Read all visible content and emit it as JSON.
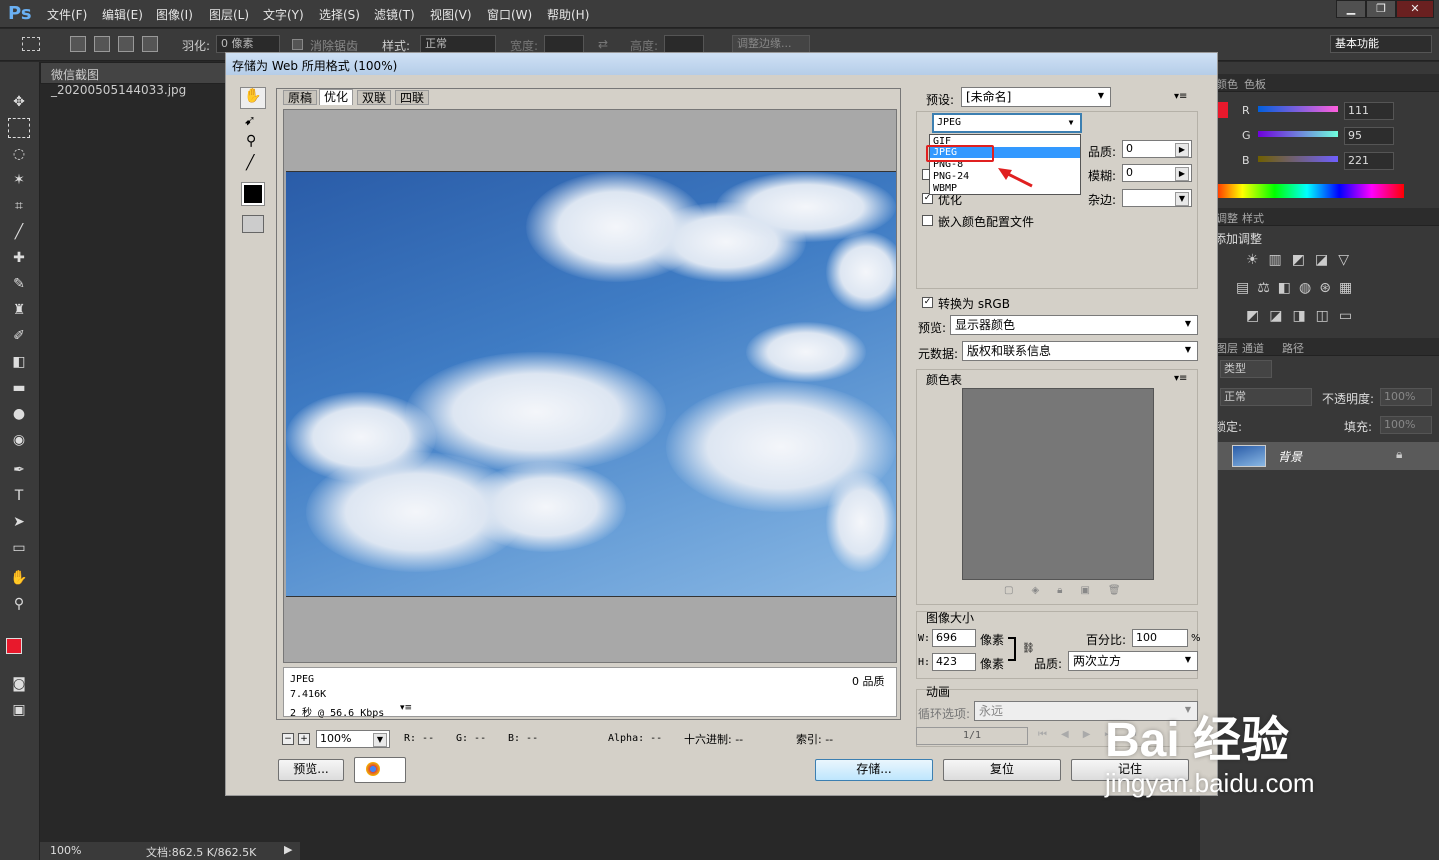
{
  "app": {
    "logo": "Ps"
  },
  "menu": [
    "文件(F)",
    "编辑(E)",
    "图像(I)",
    "图层(L)",
    "文字(Y)",
    "选择(S)",
    "滤镜(T)",
    "视图(V)",
    "窗口(W)",
    "帮助(H)"
  ],
  "window_controls": {
    "min": "▁",
    "restore": "❐",
    "close": "✕"
  },
  "options": {
    "feather_label": "羽化:",
    "feather_value": "0 像素",
    "antialias": "消除锯齿",
    "style_label": "样式:",
    "style_value": "正常",
    "width_label": "宽度:",
    "height_label": "高度:",
    "refine": "调整边缘...",
    "workspace": "基本功能"
  },
  "document": {
    "tab": "微信截图_20200505144033.jpg",
    "zoom": "100%",
    "doc_size": "文档:862.5 K/862.5K"
  },
  "dialog": {
    "title": "存储为 Web 所用格式 (100%)",
    "tabs": [
      "原稿",
      "优化",
      "双联",
      "四联"
    ],
    "info": {
      "format": "JPEG",
      "size": "7.416K",
      "speed": "2 秒 @ 56.6 Kbps",
      "quality_right": "0 品质"
    },
    "preset_label": "预设:",
    "preset_value": "[未命名]",
    "format_value": "JPEG",
    "format_options": [
      "GIF",
      "JPEG",
      "PNG-8",
      "PNG-24",
      "WBMP"
    ],
    "quality_label": "品质:",
    "quality_value": "0",
    "blur_label": "模糊:",
    "blur_value": "0",
    "matte_label": "杂边:",
    "optimized_label": "优化",
    "embed_profile": "嵌入颜色配置文件",
    "convert_srgb": "转换为 sRGB",
    "preview_label": "预览:",
    "preview_value": "显示器颜色",
    "metadata_label": "元数据:",
    "metadata_value": "版权和联系信息",
    "color_table": "颜色表",
    "image_size": "图像大小",
    "w_label": "W:",
    "w_value": "696",
    "h_label": "H:",
    "h_value": "423",
    "px": "像素",
    "percent_label": "百分比:",
    "percent_value": "100",
    "percent_sign": "%",
    "resample_label": "品质:",
    "resample_value": "两次立方",
    "animation": "动画",
    "loop_label": "循环选项:",
    "loop_value": "永远",
    "frame": "1/1",
    "zoom_value": "100%",
    "readout": {
      "r": "R: --",
      "g": "G: --",
      "b": "B: --",
      "alpha": "Alpha: --",
      "hex": "十六进制: --",
      "index": "索引: --"
    },
    "preview_btn": "预览...",
    "save_btn": "存储...",
    "reset_btn": "复位",
    "remember_btn": "记住"
  },
  "color_panel": {
    "tabs": [
      "颜色",
      "色板"
    ],
    "r_label": "R",
    "r": "111",
    "g_label": "G",
    "g": "95",
    "b_label": "B",
    "b": "221"
  },
  "adjust_panel": {
    "tabs": [
      "调整",
      "样式"
    ],
    "title": "添加调整"
  },
  "layers_panel": {
    "tabs": [
      "图层",
      "通道",
      "路径"
    ],
    "kind": "类型",
    "blend": "正常",
    "opacity_label": "不透明度:",
    "opacity": "100%",
    "lock_label": "锁定:",
    "fill_label": "填充:",
    "fill": "100%",
    "layer_name": "背景"
  },
  "watermark": {
    "text": "Bai 经验",
    "url": "jingyan.baidu.com"
  },
  "colors": {
    "foreground": "#e8192c",
    "background": "#6f5fdd",
    "highlight_box": "#e02020"
  }
}
